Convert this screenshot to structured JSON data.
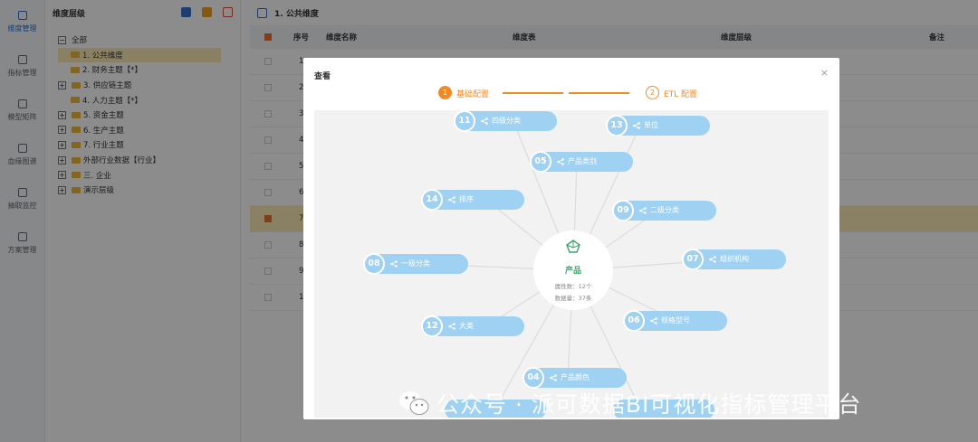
{
  "nav": {
    "items": [
      {
        "label": "维度管理",
        "icon": "cube-icon",
        "active": true
      },
      {
        "label": "指标管理",
        "icon": "monitor-icon"
      },
      {
        "label": "模型矩阵",
        "icon": "grid-icon"
      },
      {
        "label": "血缘图谱",
        "icon": "lineage-icon"
      },
      {
        "label": "抽取监控",
        "icon": "cloud-icon"
      },
      {
        "label": "方案管理",
        "icon": "layers-icon"
      }
    ]
  },
  "tree": {
    "title": "维度层级",
    "nodes": [
      {
        "label": "全部",
        "level": 0,
        "expand": "minus"
      },
      {
        "label": "1. 公共维度",
        "level": 1,
        "selected": true
      },
      {
        "label": "2. 财务主题【*】",
        "level": 1
      },
      {
        "label": "3. 供应链主题",
        "level": 1,
        "expand": "plus"
      },
      {
        "label": "4. 人力主题【*】",
        "level": 1
      },
      {
        "label": "5. 资金主题",
        "level": 1,
        "expand": "plus"
      },
      {
        "label": "6. 生产主题",
        "level": 1,
        "expand": "plus"
      },
      {
        "label": "7. 行业主题",
        "level": 1,
        "expand": "plus"
      },
      {
        "label": "外部行业数据【行业】",
        "level": 1,
        "expand": "plus"
      },
      {
        "label": "三. 企业",
        "level": 1,
        "expand": "plus"
      },
      {
        "label": "演示层级",
        "level": 1,
        "expand": "plus"
      }
    ]
  },
  "main": {
    "breadcrumb": "1. 公共维度",
    "columns": [
      "序号",
      "维度名称",
      "维度表",
      "维度层级",
      "备注"
    ],
    "rows": [
      "1",
      "2",
      "3",
      "4",
      "5",
      "6",
      "7",
      "8",
      "9",
      "10"
    ],
    "selected_row": 6
  },
  "modal": {
    "title": "查看",
    "close": "×",
    "steps": [
      {
        "num": "1",
        "label": "基础配置"
      },
      {
        "num": "2",
        "label": "ETL 配置"
      }
    ],
    "center": {
      "name": "产品",
      "attr_count": "属性数：12个",
      "data_count": "数据量：37条"
    },
    "nodes": [
      {
        "num": "11",
        "label": "四级分类"
      },
      {
        "num": "13",
        "label": "单位"
      },
      {
        "num": "05",
        "label": "产品类别"
      },
      {
        "num": "14",
        "label": "排序"
      },
      {
        "num": "09",
        "label": "二级分类"
      },
      {
        "num": "08",
        "label": "一级分类"
      },
      {
        "num": "07",
        "label": "组织机构"
      },
      {
        "num": "12",
        "label": "大类"
      },
      {
        "num": "06",
        "label": "规格型号"
      },
      {
        "num": "04",
        "label": "产品颜色"
      }
    ]
  },
  "watermark": "公众号 · 派可数据BI可视化指标管理平台",
  "colors": {
    "accent": "#f08a24",
    "node": "#9ed1f2",
    "center_text": "#3aa36b",
    "selected_row": "#fbe9b4"
  }
}
